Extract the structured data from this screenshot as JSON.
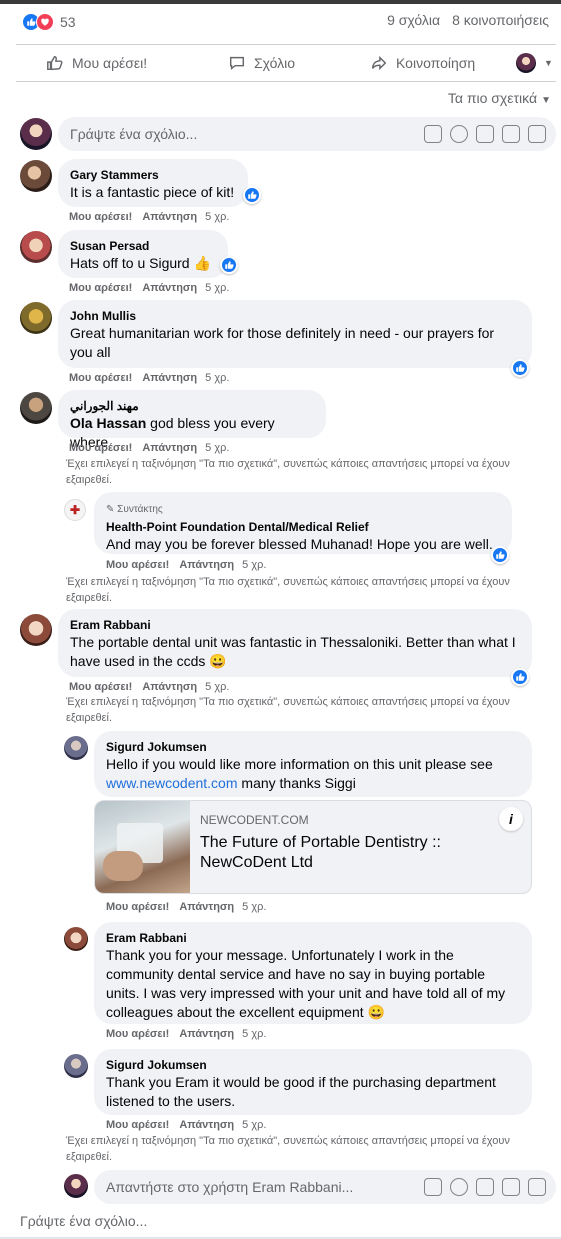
{
  "post": {
    "reaction_count": "53",
    "comments_count": "9 σχόλια",
    "shares_count": "8 κοινοποιήσεις"
  },
  "actions": {
    "like": "Μου αρέσει!",
    "comment": "Σχόλιο",
    "share": "Κοινοποίηση"
  },
  "sort": {
    "label": "Τα πιο σχετικά"
  },
  "composer": {
    "placeholder": "Γράψτε ένα σχόλιο..."
  },
  "comment_actions": {
    "like": "Μου αρέσει!",
    "reply": "Απάντηση"
  },
  "sort_note": "Έχει επιλεγεί η ταξινόμηση \"Τα πιο σχετικά\", συνεπώς κάποιες απαντήσεις μπορεί να έχουν εξαιρεθεί.",
  "comments": [
    {
      "name": "Gary Stammers",
      "text": "It is a fantastic piece of kit!",
      "time": "5 χρ."
    },
    {
      "name": "Susan Persad",
      "text": "Hats off to u Sigurd 👍",
      "time": "5 χρ."
    },
    {
      "name": "John Mullis",
      "text": "Great humanitarian work for those definitely in need - our prayers for you all",
      "time": "5 χρ."
    },
    {
      "name": "مهند الجوراني",
      "mention": "Ola Hassan",
      "text": " god bless you every where",
      "time": "5 χρ."
    },
    {
      "name": "Eram Rabbani",
      "text": "The portable dental unit was fantastic in Thessaloniki. Better than what I have used in the ccds 😀",
      "time": "5 χρ."
    }
  ],
  "replies": [
    {
      "badge": "Συντάκτης",
      "name": "Health-Point Foundation Dental/Medical Relief",
      "text": "And may you be forever blessed Muhanad! Hope you are well.",
      "time": "5 χρ."
    },
    {
      "name": "Sigurd Jokumsen",
      "text_before": "Hello if you would like more information on this unit please see ",
      "link": "www.newcodent.com",
      "text_after": " many thanks Siggi",
      "time": "5 χρ."
    },
    {
      "name": "Eram Rabbani",
      "text": "Thank you for your message. Unfortunately I work in the community dental service and have no say in buying portable units. I was very impressed with your unit and have told all of my colleagues about the excellent equipment 😀",
      "time": "5 χρ."
    },
    {
      "name": "Sigurd Jokumsen",
      "text": "Thank you Eram it would be good if the purchasing department listened to the users.",
      "time": "5 χρ."
    }
  ],
  "link_preview": {
    "domain": "NEWCODENT.COM",
    "title": "The Future of Portable Dentistry :: NewCoDent Ltd"
  },
  "reply_composer": {
    "placeholder": "Απαντήστε στο χρήστη Eram Rabbani..."
  },
  "bottom_composer": {
    "placeholder": "Γράψτε ένα σχόλιο..."
  }
}
